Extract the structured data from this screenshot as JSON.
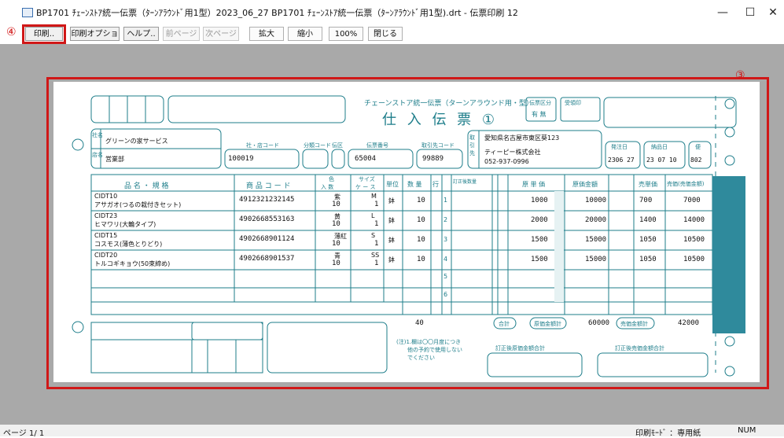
{
  "window": {
    "title": "BP1701 ﾁｪｰﾝｽﾄｱ統一伝票（ﾀｰﾝｱﾗｳﾝﾄﾞ用1型）2023_06_27 BP1701 ﾁｪｰﾝｽﾄｱ統一伝票（ﾀｰﾝｱﾗｳﾝﾄﾞ用1型).drt - 伝票印刷 12",
    "minimize": "—",
    "maximize": "☐",
    "close": "✕"
  },
  "annotations": {
    "toolbar_marker": "④",
    "paper_marker": "③"
  },
  "toolbar": {
    "print": "印刷..",
    "print_options": "印刷オプション..",
    "help": "ヘルプ..",
    "prev_page": "前ページ",
    "next_page": "次ページ",
    "zoom_in": "拡大",
    "zoom_out": "縮小",
    "zoom_level": "100%",
    "close": "閉じる"
  },
  "status": {
    "page": "ページ 1/ 1",
    "mode": "印刷ﾓｰﾄﾞ ：専用紙",
    "num": "NUM"
  },
  "colors": {
    "form": "#1d7d8a",
    "band": "#2f8a9c",
    "annotation": "#d01818",
    "workspace": "#a9a9a9"
  },
  "form": {
    "header_small": "チェーンストア統一伝票（ターンアラウンド用・型）",
    "title": "仕 入 伝 票 ①",
    "title_circle": "①",
    "label_shop": "社名",
    "label_store": "店名",
    "label_torihikisaki": "取引先",
    "label_shop_code": "社・店コード",
    "label_bunrui": "分類コード",
    "label_denpyo_kubun": "伝区",
    "label_denpyo_no": "伝票番号",
    "label_torihikisaki_code": "取引先コード",
    "label_order_date": "発注日",
    "label_delivery_date": "納品日",
    "label_bin": "便",
    "label_kubun": "伝票区分",
    "label_kubun_value": "有 無",
    "label_receipt": "受領印",
    "company": "グリーンの家サービス",
    "store": "営業部",
    "shop_code": "100019",
    "denpyo_no": "65004",
    "torihikisaki_code": "99889",
    "supplier_address": "愛知県名古屋市東区葵123",
    "supplier_name": "ティーピー株式会社",
    "supplier_tel": "052-937-0996",
    "order_date": "2306 27",
    "delivery_date": "23 07 10",
    "bin": "802",
    "col_headers": {
      "name": "品 名 ・ 規 格",
      "code": "商 品 コ ー ド",
      "color": "色",
      "size": "サイズ",
      "irisu": "入 数",
      "case": "ケ ー ス",
      "unit": "単位",
      "qty": "数 量",
      "line": "行",
      "teisei": "訂正後数量",
      "genka_tanka": "原 単 価",
      "genka_kingaku": "原価金額",
      "baika": "売単価",
      "baika_kingaku": "売価(売価金額)"
    },
    "items": [
      {
        "code_name": "CIDT10",
        "name": "アサガオ(つるの栽付きセット)",
        "jan": "4912321232145",
        "color": "紫",
        "size": "M",
        "irisu": "10",
        "case": "1",
        "unit": "鉢",
        "qty": "10",
        "line": "1",
        "genka_tanka": "1000",
        "genka_kingaku": "10000",
        "baika": "700",
        "baika_kingaku": "7000"
      },
      {
        "code_name": "CIDT23",
        "name": "ヒマワリ(大輪タイプ)",
        "jan": "4902668553163",
        "color": "黄",
        "size": "L",
        "irisu": "10",
        "case": "1",
        "unit": "鉢",
        "qty": "10",
        "line": "2",
        "genka_tanka": "2000",
        "genka_kingaku": "20000",
        "baika": "1400",
        "baika_kingaku": "14000"
      },
      {
        "code_name": "CIDT15",
        "name": "コスモス(薄色とりどり)",
        "jan": "4902668901124",
        "color": "薄紅",
        "size": "S",
        "irisu": "10",
        "case": "1",
        "unit": "鉢",
        "qty": "10",
        "line": "3",
        "genka_tanka": "1500",
        "genka_kingaku": "15000",
        "baika": "1050",
        "baika_kingaku": "10500"
      },
      {
        "code_name": "CIDT20",
        "name": "トルコギキョウ(50束締め)",
        "jan": "4902668901537",
        "color": "青",
        "size": "SS",
        "irisu": "10",
        "case": "1",
        "unit": "鉢",
        "qty": "10",
        "line": "4",
        "genka_tanka": "1500",
        "genka_kingaku": "15000",
        "baika": "1050",
        "baika_kingaku": "10500"
      }
    ],
    "empty_lines": [
      "5",
      "6"
    ],
    "total_qty": "40",
    "total_label": "合計",
    "genka_total_label": "原価金額計",
    "genka_total": "60000",
    "baika_total_label": "売価金額計",
    "baika_total": "42000",
    "note": "(注)1.欄は〇〇月度につき\n　　他の予約で使用しない\n　　でください",
    "footer_left": "訂正後原価金額合計",
    "footer_right": "訂正後売価金額合計"
  }
}
